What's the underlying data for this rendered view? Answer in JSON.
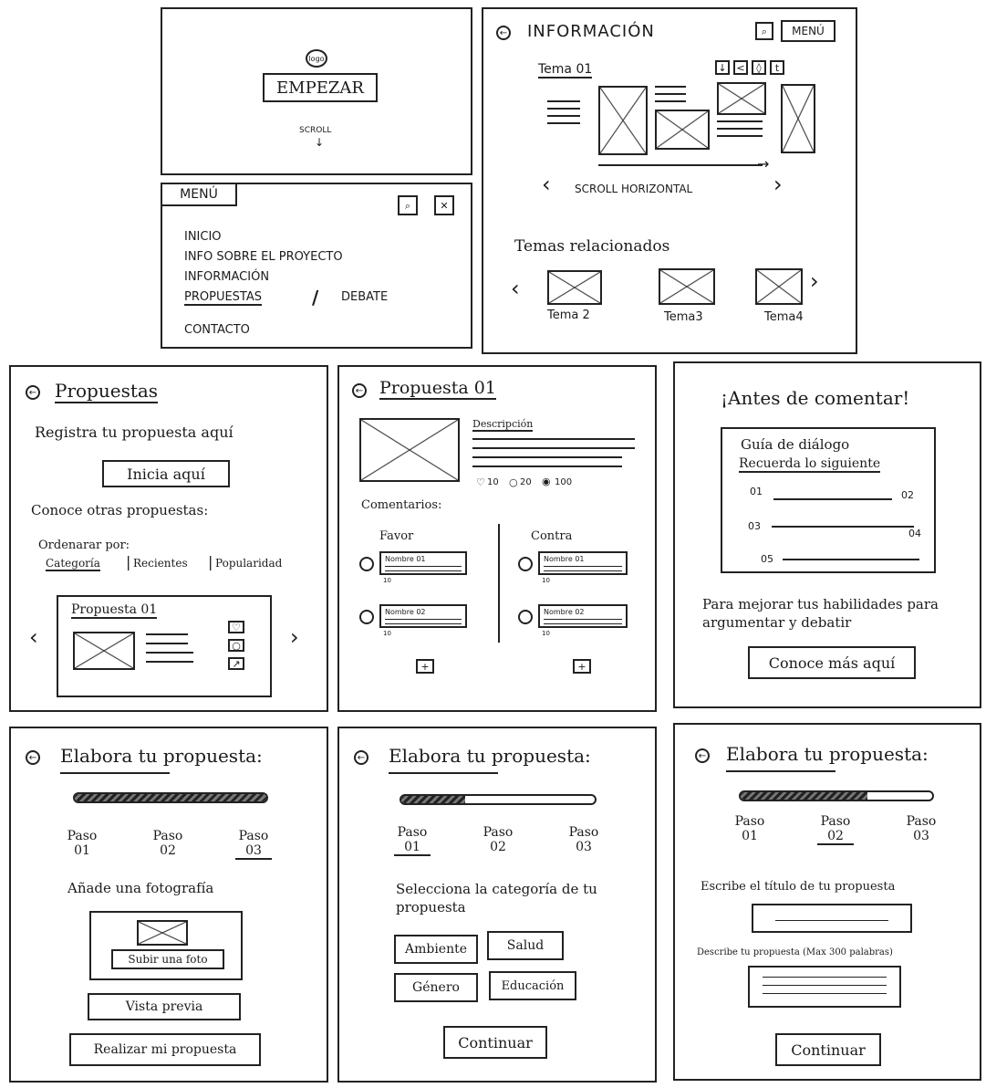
{
  "p1": {
    "logo": "logo",
    "start": "EMPEZAR",
    "scroll": "SCROLL",
    "scroll_arrow": "↓"
  },
  "p2": {
    "title": "INFORMACIÓN",
    "menu": "MENÚ",
    "tema": "Tema 01",
    "scroll_label": "SCROLL HORIZONTAL",
    "related": "Temas relacionados",
    "related_items": [
      "Tema 2",
      "Tema3",
      "Tema4"
    ]
  },
  "p3": {
    "title": "MENÚ",
    "items": [
      "INICIO",
      "INFO SOBRE EL PROYECTO",
      "INFORMACIÓN",
      "PROPUESTAS",
      "DEBATE",
      "CONTACTO"
    ],
    "separator": "/"
  },
  "p4": {
    "title": "Propuestas",
    "register": "Registra tu propuesta aquí",
    "start_button": "Inicia aquí",
    "discover": "Conoce otras propuestas:",
    "order_by": "Ordenarar por:",
    "filters": [
      "Categoría",
      "Recientes",
      "Popularidad"
    ],
    "card_title": "Propuesta 01"
  },
  "p5": {
    "title": "Propuesta 01",
    "description": "Descripción",
    "likes": "10",
    "comments": "20",
    "views": "100",
    "comments_label": "Comentarios:",
    "favor": "Favor",
    "contra": "Contra",
    "comment_names": [
      "Nombre 01",
      "Nombre 02"
    ],
    "comment_likes": "10"
  },
  "p6": {
    "title": "¡Antes de comentar!",
    "guide_title": "Guía de diálogo",
    "remember": "Recuerda lo siguiente",
    "numbers": [
      "01",
      "02",
      "03",
      "04",
      "05"
    ],
    "improve_text": "Para mejorar tus habilidades para argumentar y debatir",
    "button": "Conoce más aquí"
  },
  "p7": {
    "title": "Elabora tu propuesta:",
    "steps": [
      "Paso 01",
      "Paso 02",
      "Paso 03"
    ],
    "progress": 1.0,
    "add_photo": "Añade una fotografía",
    "upload": "Subir una foto",
    "preview": "Vista previa",
    "submit": "Realizar mi propuesta"
  },
  "p8": {
    "title": "Elabora tu propuesta:",
    "steps": [
      "Paso 01",
      "Paso 02",
      "Paso 03"
    ],
    "progress": 0.33,
    "select_label": "Selecciona la categoría de tu propuesta",
    "categories": [
      "Ambiente",
      "Salud",
      "Género",
      "Educación"
    ],
    "continue": "Continuar"
  },
  "p9": {
    "title": "Elabora tu propuesta:",
    "steps": [
      "Paso 01",
      "Paso 02",
      "Paso 03"
    ],
    "progress": 0.66,
    "title_label": "Escribe el título de tu propuesta",
    "describe_label": "Describe tu propuesta (Max 300 palabras)",
    "continue": "Continuar"
  }
}
